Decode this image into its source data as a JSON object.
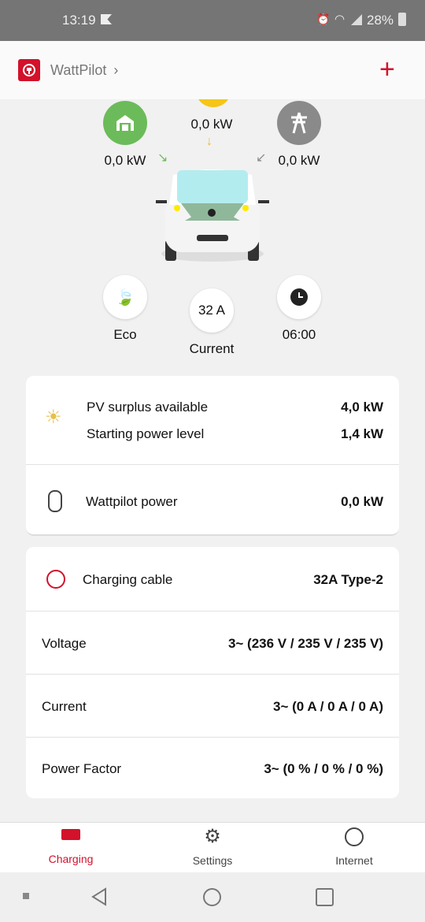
{
  "status_bar": {
    "time": "13:19",
    "battery": "28%"
  },
  "header": {
    "title": "WattPilot",
    "add_icon": "plus-icon"
  },
  "flow": {
    "solar_power": "0,0 kW",
    "home_power": "0,0 kW",
    "grid_power": "0,0 kW"
  },
  "controls": {
    "mode_label": "Eco",
    "current_value": "32 A",
    "current_label": "Current",
    "time_value": "06:00"
  },
  "card1": {
    "pv_surplus_label": "PV surplus available",
    "pv_surplus_value": "4,0 kW",
    "starting_label": "Starting power level",
    "starting_value": "1,4 kW",
    "wattpilot_label": "Wattpilot power",
    "wattpilot_value": "0,0 kW"
  },
  "card2": {
    "rows": [
      {
        "label": "Charging cable",
        "value": "32A Type-2"
      },
      {
        "label": "Voltage",
        "value": "3~ (236 V / 235 V / 235 V)"
      },
      {
        "label": "Current",
        "value": "3~ (0 A / 0 A / 0 A)"
      },
      {
        "label": "Power Factor",
        "value": "3~ (0 % / 0 % / 0 %)"
      }
    ]
  },
  "nav": {
    "items": [
      {
        "label": "Charging"
      },
      {
        "label": "Settings"
      },
      {
        "label": "Internet"
      }
    ]
  },
  "colors": {
    "accent": "#d3112b",
    "green": "#6cbb5a",
    "solar": "#f5c518",
    "grid": "#8a8a8a"
  }
}
